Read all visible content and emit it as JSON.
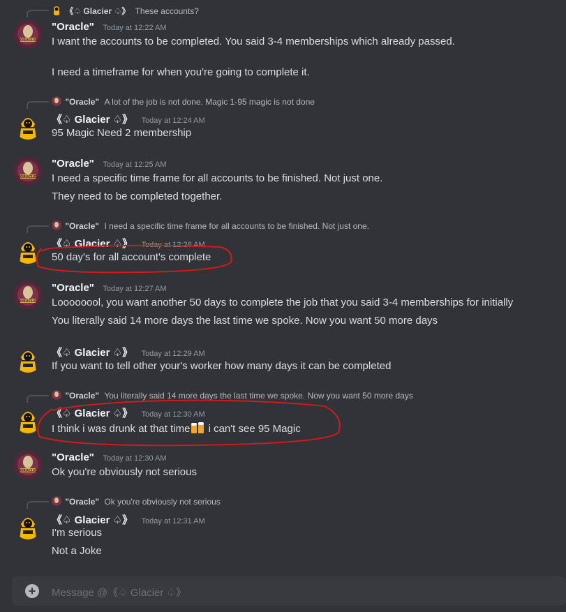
{
  "colors": {
    "background": "#313338",
    "text": "#dbdee1",
    "muted": "#949ba4",
    "annotation": "#d11a1a",
    "composer_bg": "#383a40"
  },
  "messages": [
    {
      "reply": {
        "name": "《♤ Glacier ♤》",
        "text": "These accounts?"
      },
      "author": "\"Oracle\"",
      "time": "Today at 12:22 AM",
      "avatar": "oracle",
      "lines": [
        "I want the accounts to be completed. You said 3-4 memberships which already passed.",
        "",
        "I need a timeframe for when you're going to complete it."
      ]
    },
    {
      "reply": {
        "name": "\"Oracle\"",
        "text": "A lot of the job is not done. Magic 1-95 magic is not done"
      },
      "author": "《♤ Glacier ♤》",
      "time": "Today at 12:24 AM",
      "avatar": "glacier",
      "lines": [
        "95 Magic Need 2 membership"
      ]
    },
    {
      "author": "\"Oracle\"",
      "time": "Today at 12:25 AM",
      "avatar": "oracle",
      "lines": [
        "I need a specific time frame for all accounts to be finished. Not just one.",
        "They need to be completed together."
      ]
    },
    {
      "reply": {
        "name": "\"Oracle\"",
        "text": "I need a specific time frame for all accounts to be finished. Not just one."
      },
      "author": "《♤ Glacier ♤》",
      "time": "Today at 12:26 AM",
      "avatar": "glacier",
      "lines": [
        "50 day's for all account's complete"
      ]
    },
    {
      "author": "\"Oracle\"",
      "time": "Today at 12:27 AM",
      "avatar": "oracle",
      "lines": [
        "Loooooool, you want another 50 days to complete the job that you said 3-4 memberships for initially",
        "You literally said 14 more days the last time we spoke. Now you want 50 more days"
      ]
    },
    {
      "author": "《♤ Glacier ♤》",
      "time": "Today at 12:29 AM",
      "avatar": "glacier",
      "lines": [
        "If you want to tell other your's worker how many days it can be completed"
      ]
    },
    {
      "reply": {
        "name": "\"Oracle\"",
        "text": "You literally said 14 more days the last time we spoke. Now you want 50 more days"
      },
      "author": "《♤ Glacier ♤》",
      "time": "Today at 12:30 AM",
      "avatar": "glacier",
      "lines_rich": {
        "before": "I think i was drunk at that time",
        "emoji": "beers-emoji",
        "after": " i can't see 95 Magic"
      }
    },
    {
      "author": "\"Oracle\"",
      "time": "Today at 12:30 AM",
      "avatar": "oracle",
      "lines": [
        "Ok you're obviously not serious"
      ]
    },
    {
      "reply": {
        "name": "\"Oracle\"",
        "text": "Ok you're obviously not serious"
      },
      "author": "《♤ Glacier ♤》",
      "time": "Today at 12:31 AM",
      "avatar": "glacier",
      "lines": [
        "I'm serious",
        "Not a Joke"
      ]
    }
  ],
  "composer": {
    "placeholder": "Message @《♤ Glacier ♤》",
    "plus_icon": "plus-circle-icon"
  }
}
